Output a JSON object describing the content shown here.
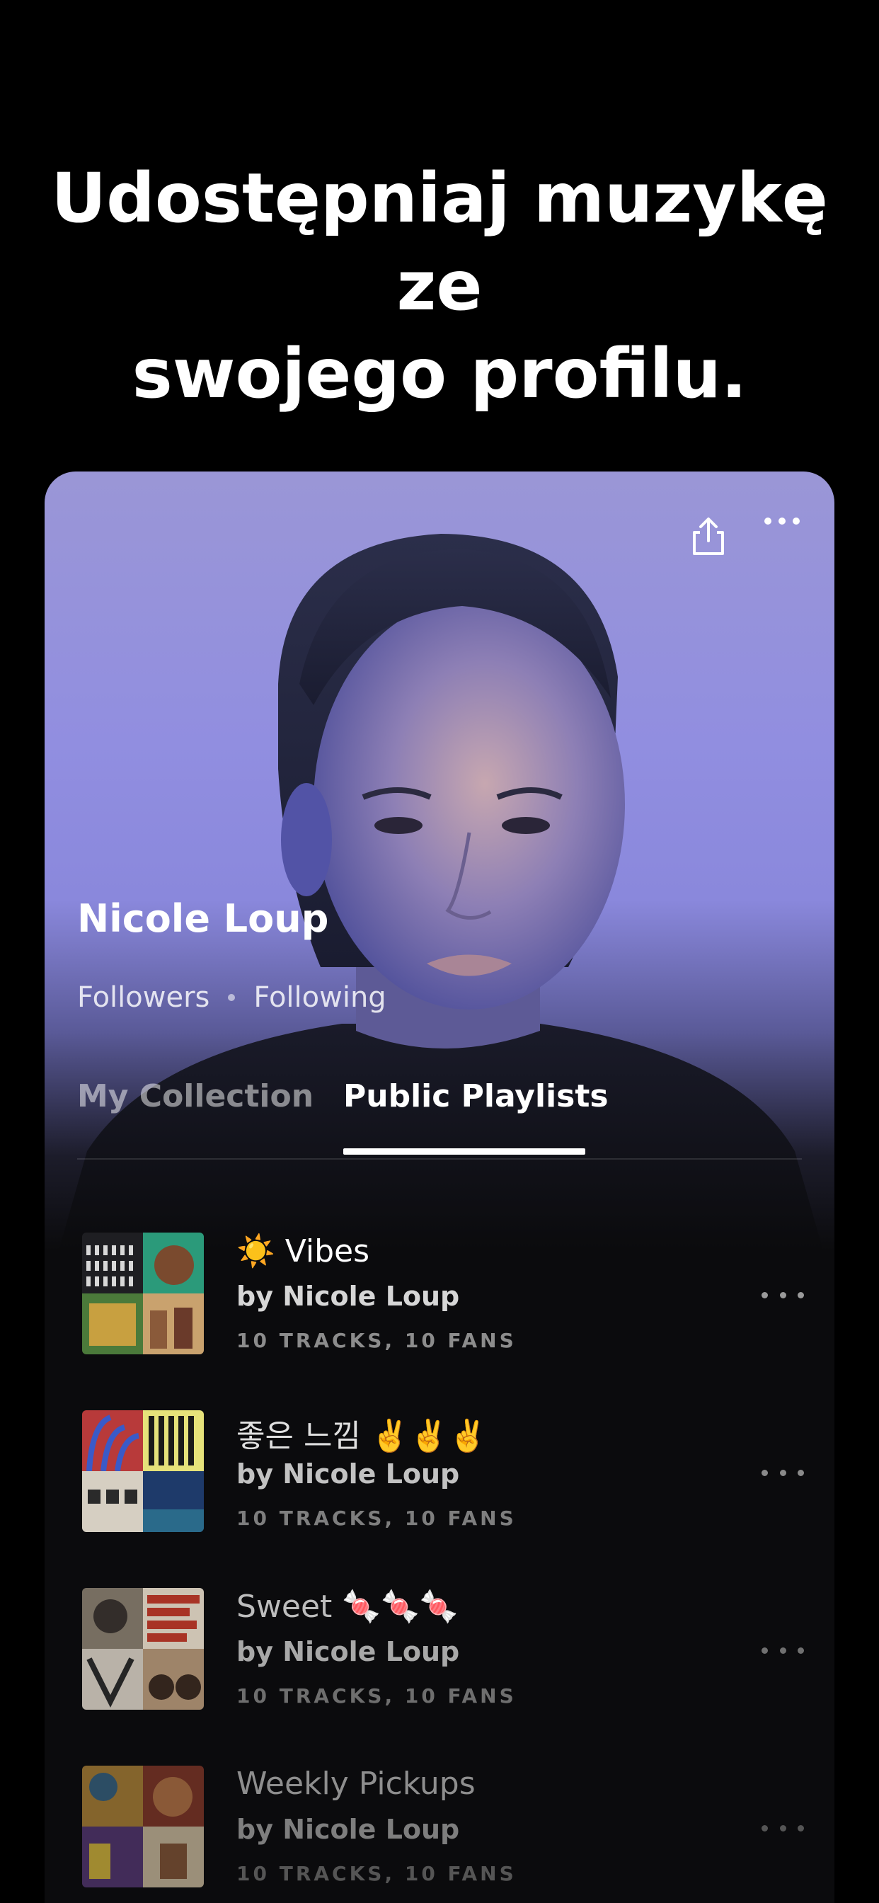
{
  "headline": {
    "line1": "Udostępniaj muzykę ze",
    "line2": "swojego profilu."
  },
  "profile": {
    "name": "Nicole Loup",
    "followers_label": "Followers",
    "following_label": "Following"
  },
  "tabs": [
    {
      "label": "My Collection",
      "active": false
    },
    {
      "label": "Public Playlists",
      "active": true
    }
  ],
  "playlists": [
    {
      "title": "☀️ Vibes",
      "owner": "by Nicole Loup",
      "meta": "10 TRACKS, 10 FANS"
    },
    {
      "title": "좋은 느낌 ✌️✌️✌️",
      "owner": "by Nicole Loup",
      "meta": "10 TRACKS, 10 FANS"
    },
    {
      "title": "Sweet 🍬🍬🍬",
      "owner": "by Nicole Loup",
      "meta": "10 TRACKS, 10 FANS"
    },
    {
      "title": "Weekly Pickups",
      "owner": "by Nicole Loup",
      "meta": "10 TRACKS, 10 FANS"
    }
  ],
  "icons": {
    "share": "share-icon",
    "more": "more-horizontal-icon"
  },
  "colors": {
    "background": "#000000",
    "hero_purple": "#918ee0",
    "text_primary": "#ffffff"
  }
}
